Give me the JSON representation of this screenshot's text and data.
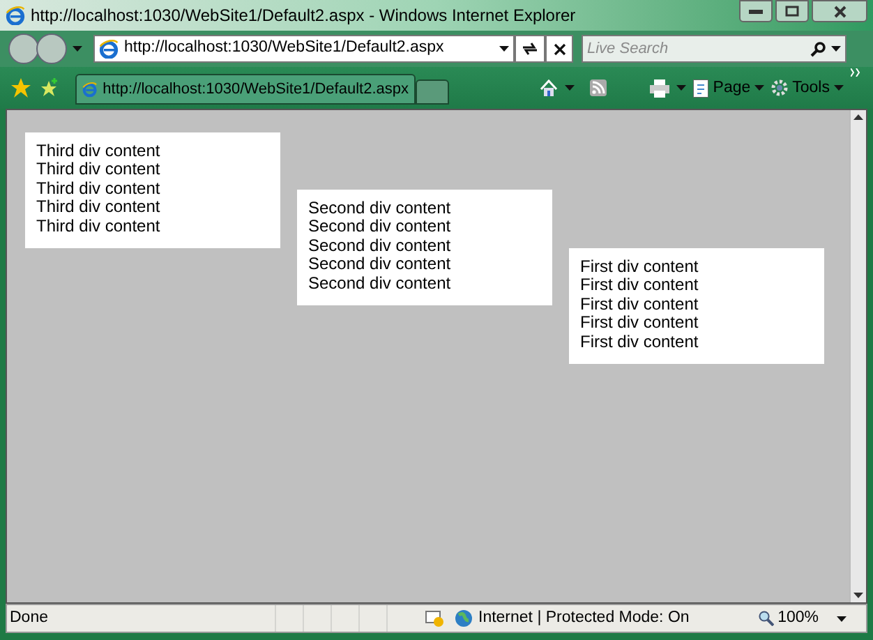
{
  "window": {
    "title": "http://localhost:1030/WebSite1/Default2.aspx - Windows Internet Explorer"
  },
  "address_bar": {
    "value": "http://localhost:1030/WebSite1/Default2.aspx"
  },
  "search": {
    "placeholder": "Live Search"
  },
  "tabs": [
    {
      "label": "http://localhost:1030/WebSite1/Default2.aspx",
      "selected": true
    }
  ],
  "command_bar": {
    "page": "Page",
    "tools": "Tools"
  },
  "divs": [
    {
      "lines": [
        "Third div content",
        "Third div content",
        "Third div content",
        "Third div content",
        "Third div content"
      ]
    },
    {
      "lines": [
        "Second div content",
        "Second div content",
        "Second div content",
        "Second div content",
        "Second div content"
      ]
    },
    {
      "lines": [
        "First div content",
        "First div content",
        "First div content",
        "First div content",
        "First div content"
      ]
    }
  ],
  "status_bar": {
    "status": "Done",
    "zone": "Internet | Protected Mode: On",
    "zoom": "100%"
  }
}
